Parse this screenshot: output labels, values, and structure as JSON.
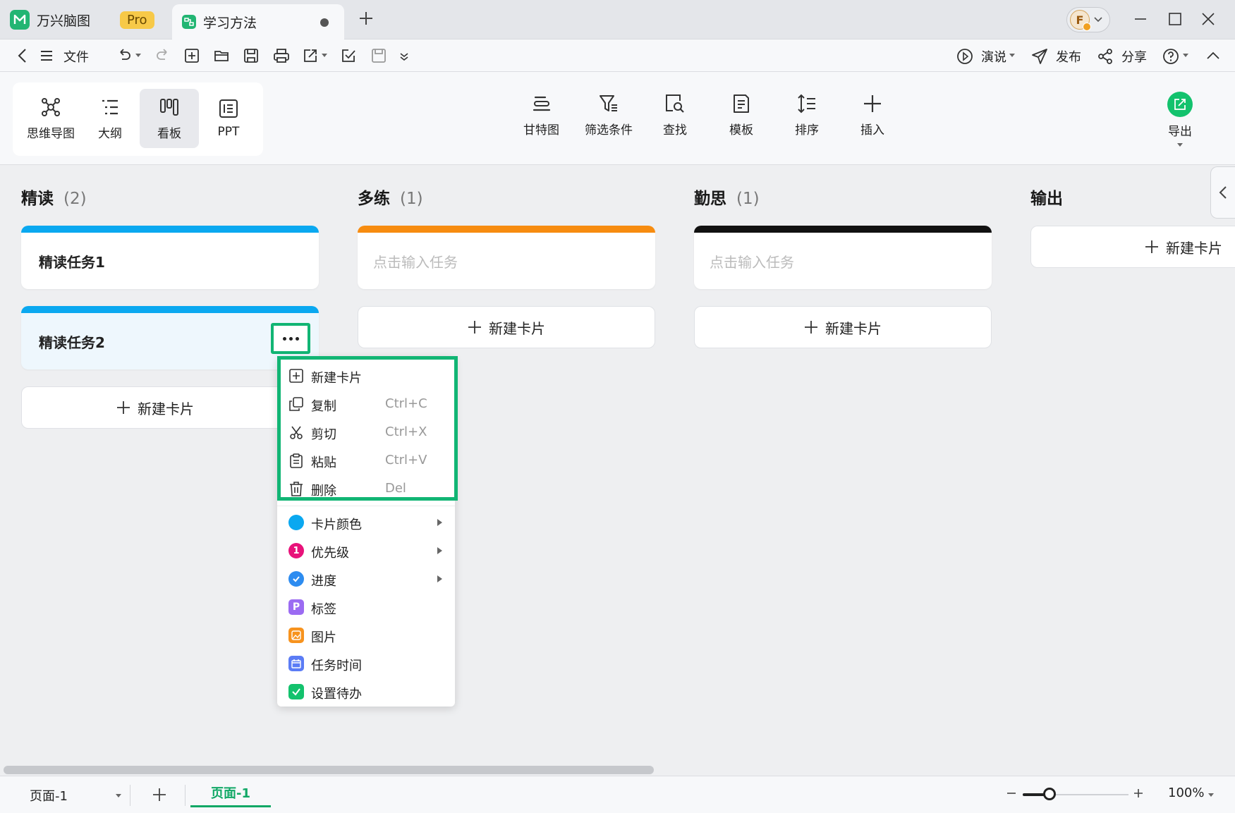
{
  "titlebar": {
    "app_name": "万兴脑图",
    "pro_label": "Pro",
    "doc_tab": "学习方法",
    "avatar_letter": "F"
  },
  "menubar": {
    "file_label": "文件",
    "present_label": "演说",
    "publish_label": "发布",
    "share_label": "分享"
  },
  "views": {
    "mindmap": "思维导图",
    "outline": "大纲",
    "kanban": "看板",
    "ppt": "PPT"
  },
  "tools": {
    "gantt": "甘特图",
    "filter": "筛选条件",
    "find": "查找",
    "template": "模板",
    "sort": "排序",
    "insert": "插入",
    "export": "导出"
  },
  "board": {
    "new_card_label": "新建卡片",
    "placeholder": "点击输入任务",
    "columns": [
      {
        "title": "精读",
        "count": "(2)",
        "color": "#0aa8f0",
        "cards": [
          "精读任务1",
          "精读任务2"
        ]
      },
      {
        "title": "多练",
        "count": "(1)",
        "color": "#f78c10",
        "cards": []
      },
      {
        "title": "勤思",
        "count": "(1)",
        "color": "#111111",
        "cards": []
      },
      {
        "title": "输出",
        "count": "",
        "color": "",
        "cards": []
      }
    ]
  },
  "context_menu": {
    "items": [
      {
        "label": "新建卡片",
        "shortcut": ""
      },
      {
        "label": "复制",
        "shortcut": "Ctrl+C"
      },
      {
        "label": "剪切",
        "shortcut": "Ctrl+X"
      },
      {
        "label": "粘贴",
        "shortcut": "Ctrl+V"
      },
      {
        "label": "删除",
        "shortcut": "Del"
      },
      {
        "label": "卡片颜色",
        "shortcut": ""
      },
      {
        "label": "优先级",
        "shortcut": ""
      },
      {
        "label": "进度",
        "shortcut": ""
      },
      {
        "label": "标签",
        "shortcut": ""
      },
      {
        "label": "图片",
        "shortcut": ""
      },
      {
        "label": "任务时间",
        "shortcut": ""
      },
      {
        "label": "设置待办",
        "shortcut": ""
      }
    ],
    "priority_badge": "1",
    "tag_badge": "P"
  },
  "statusbar": {
    "page_select": "页面-1",
    "page_tab": "页面-1",
    "zoom": "100%"
  },
  "colors": {
    "accent_green": "#11b574",
    "card_color_blue": "#0aa8f0"
  }
}
